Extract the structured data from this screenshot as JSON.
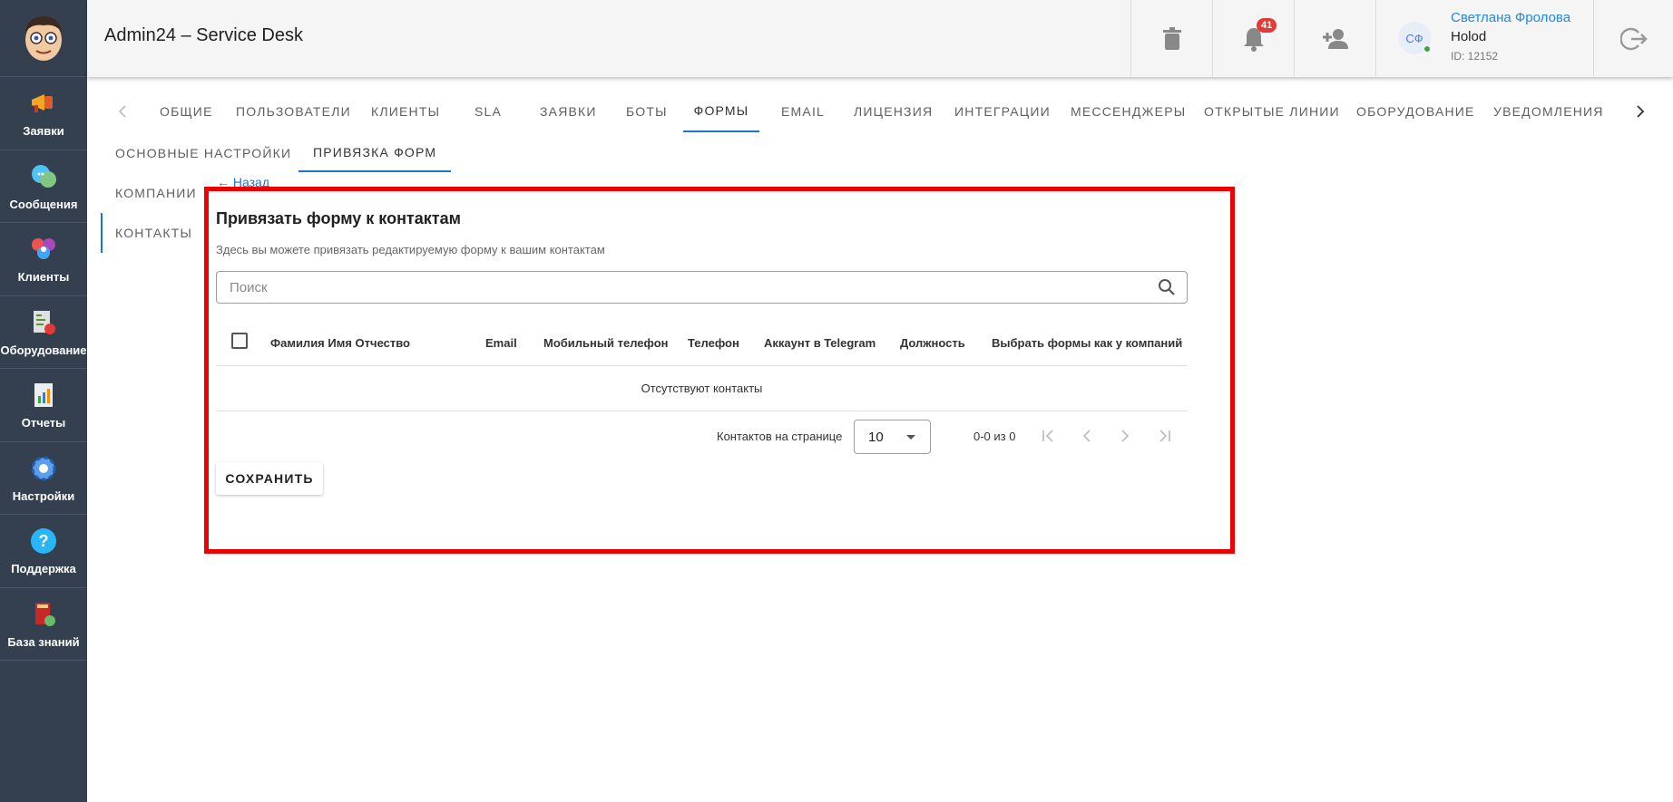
{
  "header": {
    "title": "Admin24 – Service Desk",
    "notifications_count": "41",
    "user": {
      "initials": "СФ",
      "name": "Светлана Фролова",
      "company": "Holod",
      "id": "ID: 12152"
    }
  },
  "sidebar": {
    "items": [
      {
        "label": "Заявки",
        "icon": "megaphone-icon"
      },
      {
        "label": "Сообщения",
        "icon": "chat-icon"
      },
      {
        "label": "Клиенты",
        "icon": "clients-icon"
      },
      {
        "label": "Оборудование",
        "icon": "equipment-icon"
      },
      {
        "label": "Отчеты",
        "icon": "report-icon"
      },
      {
        "label": "Настройки",
        "icon": "gear-icon"
      },
      {
        "label": "Поддержка",
        "icon": "help-icon"
      },
      {
        "label": "База знаний",
        "icon": "book-icon"
      }
    ]
  },
  "tabs": [
    "ОБЩИЕ",
    "ПОЛЬЗОВАТЕЛИ",
    "КЛИЕНТЫ",
    "SLA",
    "ЗАЯВКИ",
    "БОТЫ",
    "ФОРМЫ",
    "EMAIL",
    "ЛИЦЕНЗИЯ",
    "ИНТЕГРАЦИИ",
    "МЕССЕНДЖЕРЫ",
    "ОТКРЫТЫЕ ЛИНИИ",
    "ОБОРУДОВАНИЕ",
    "УВЕДОМЛЕНИЯ"
  ],
  "active_tab": "ФОРМЫ",
  "subtabs": [
    "ОСНОВНЫЕ НАСТРОЙКИ",
    "ПРИВЯЗКА ФОРМ"
  ],
  "vtabs": [
    "КОМПАНИИ",
    "КОНТАКТЫ"
  ],
  "back_link": "← Назад",
  "panel": {
    "title": "Привязать форму к контактам",
    "subtitle": "Здесь вы можете привязать редактируемую форму к вашим контактам",
    "search_placeholder": "Поиск",
    "columns": [
      "Фамилия Имя Отчество",
      "Email",
      "Мобильный телефон",
      "Телефон",
      "Аккаунт в Telegram",
      "Должность",
      "Выбрать формы как у компаний"
    ],
    "empty_text": "Отсутствуют контакты",
    "rows_per_page_label": "Контактов на странице",
    "rows_per_page": "10",
    "range": "0-0 из 0",
    "save_label": "СОХРАНИТЬ"
  },
  "colors": {
    "sidebar_bg": "#344050",
    "accent": "#1976d2",
    "highlight_border": "#ee0000",
    "badge": "#e53935"
  }
}
